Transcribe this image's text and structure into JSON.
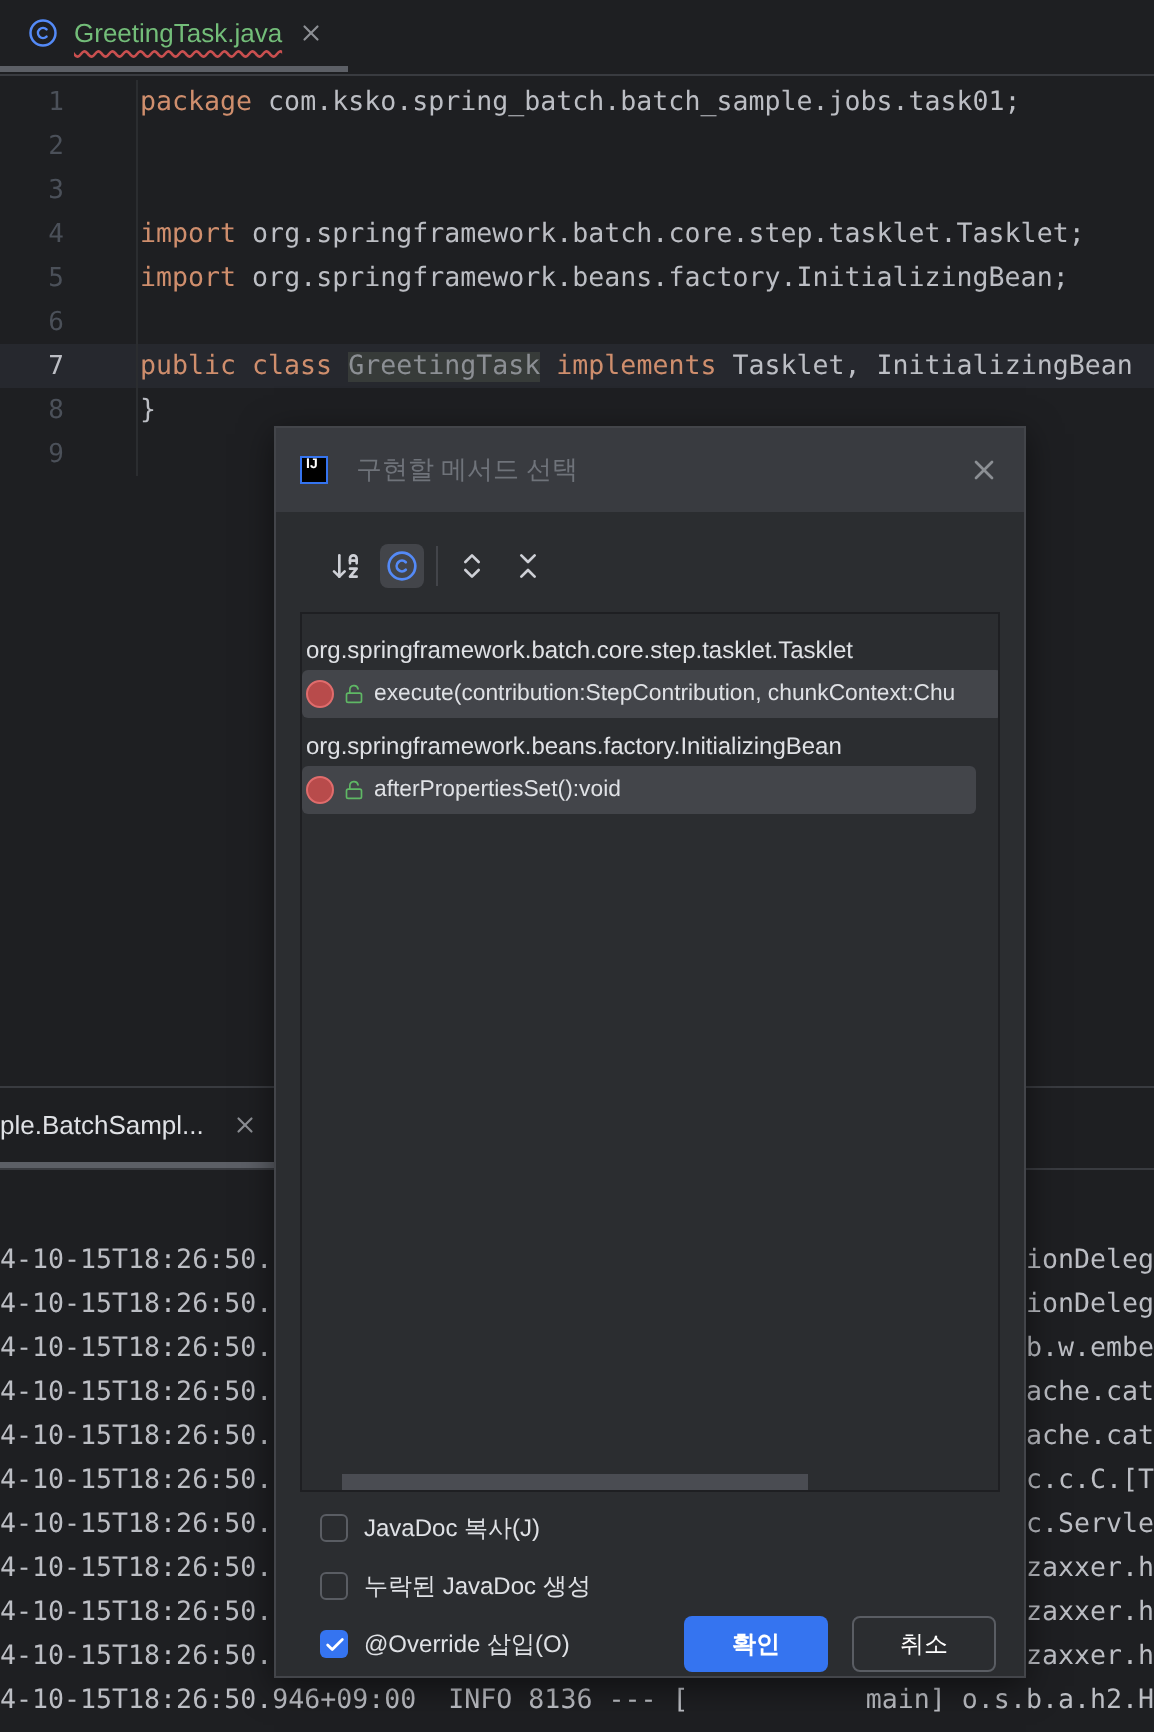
{
  "editor": {
    "tab": {
      "label": "GreetingTask.java",
      "selected": true
    },
    "lines": [
      {
        "number": "1",
        "current": false,
        "tokens": [
          {
            "kind": "keyword",
            "text": "package"
          },
          {
            "kind": "plain",
            "text": " com.ksko.spring_batch.batch_sample.jobs.task01;"
          }
        ]
      },
      {
        "number": "2",
        "current": false
      },
      {
        "number": "3",
        "current": false
      },
      {
        "number": "4",
        "current": false,
        "tokens": [
          {
            "kind": "keyword",
            "text": "import"
          },
          {
            "kind": "plain",
            "text": " org.springframework.batch.core.step.tasklet.Tasklet;"
          }
        ]
      },
      {
        "number": "5",
        "current": false,
        "tokens": [
          {
            "kind": "keyword",
            "text": "import"
          },
          {
            "kind": "plain",
            "text": " org.springframework.beans.factory.InitializingBean;"
          }
        ]
      },
      {
        "number": "6",
        "current": false
      },
      {
        "number": "7",
        "current": true,
        "tokens": [
          {
            "kind": "keyword",
            "text": "public class "
          },
          {
            "kind": "highlight",
            "text": "GreetingTask"
          },
          {
            "kind": "keyword",
            "text": " implements"
          },
          {
            "kind": "plain",
            "text": " Tasklet, InitializingBean"
          }
        ]
      },
      {
        "number": "8",
        "current": false,
        "tokens": [
          {
            "kind": "plain",
            "text": "}"
          }
        ]
      },
      {
        "number": "9",
        "current": false
      }
    ]
  },
  "console": {
    "tab": {
      "label": "ple.BatchSampl...",
      "selected": true
    },
    "rows": [
      {
        "left": "4-10-15T18:26:50.",
        "right": "ionDeleg"
      },
      {
        "left": "4-10-15T18:26:50.",
        "right": "ionDeleg"
      },
      {
        "left": "4-10-15T18:26:50.",
        "right": "b.w.embe"
      },
      {
        "left": "4-10-15T18:26:50.",
        "right": "ache.cat"
      },
      {
        "left": "4-10-15T18:26:50.",
        "right": "ache.cat"
      },
      {
        "left": "4-10-15T18:26:50.",
        "right": "c.c.C.[T"
      },
      {
        "left": "4-10-15T18:26:50.",
        "right": "c.Servle"
      },
      {
        "left": "4-10-15T18:26:50.",
        "right": "zaxxer.h"
      },
      {
        "left": "4-10-15T18:26:50.",
        "right": "zaxxer.h"
      },
      {
        "left": "4-10-15T18:26:50.",
        "right": "zaxxer.h"
      },
      {
        "left": "4-10-15T18:26:50.946+09:00  INFO 8136 --- [",
        "right": "main] o.s.b.a.h2.H"
      }
    ]
  },
  "dialog": {
    "logo_text": "IJ",
    "title": "구현할 메서드 선택",
    "toolbar": [
      {
        "kind": "sort",
        "selected": false
      },
      {
        "kind": "classes",
        "selected": true
      },
      {
        "kind": "expand",
        "selected": false
      },
      {
        "kind": "collapse",
        "selected": false
      }
    ],
    "groups": [
      {
        "name": "org.springframework.batch.core.step.tasklet.Tasklet",
        "methods": [
          {
            "signature": "execute(contribution:StepContribution, chunkContext:Chu",
            "selected": true
          }
        ]
      },
      {
        "name": "org.springframework.beans.factory.InitializingBean",
        "methods": [
          {
            "signature": "afterPropertiesSet():void",
            "selected": true
          }
        ]
      }
    ],
    "options": [
      {
        "label": "JavaDoc 복사(J)",
        "checked": false
      },
      {
        "label": "누락된 JavaDoc 생성",
        "checked": false
      },
      {
        "label": "@Override 삽입(O)",
        "checked": true
      }
    ],
    "buttons": [
      {
        "label": "확인",
        "kind": "primary"
      },
      {
        "label": "취소",
        "kind": "secondary"
      }
    ]
  }
}
